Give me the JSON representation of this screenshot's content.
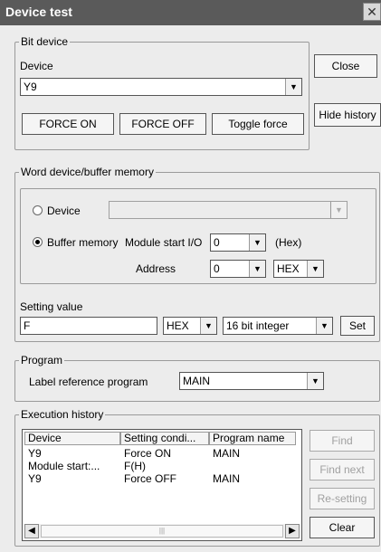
{
  "window": {
    "title": "Device test"
  },
  "side_buttons": {
    "close": "Close",
    "hide_history": "Hide history"
  },
  "bit_device": {
    "group_label": "Bit device",
    "device_label": "Device",
    "device_value": "Y9",
    "force_on": "FORCE ON",
    "force_off": "FORCE OFF",
    "toggle_force": "Toggle force"
  },
  "word_device": {
    "group_label": "Word device/buffer memory",
    "device_radio_label": "Device",
    "device_selected": false,
    "buffer_radio_label": "Buffer memory",
    "buffer_selected": true,
    "module_start_label": "Module start I/O",
    "module_start_value": "0",
    "hex_label": "(Hex)",
    "address_label": "Address",
    "address_value": "0",
    "address_format": "HEX"
  },
  "setting_value": {
    "label": "Setting value",
    "value": "F",
    "format": "HEX",
    "type": "16 bit integer",
    "set_button": "Set"
  },
  "program": {
    "group_label": "Program",
    "label_ref": "Label reference program",
    "value": "MAIN"
  },
  "history": {
    "group_label": "Execution history",
    "columns": [
      "Device",
      "Setting condi...",
      "Program name"
    ],
    "rows": [
      [
        "Y9",
        "Force ON",
        "MAIN"
      ],
      [
        "Module start:...",
        "F(H)",
        ""
      ],
      [
        "Y9",
        "Force OFF",
        "MAIN"
      ]
    ],
    "scroll_grip": "|||",
    "buttons": {
      "find": "Find",
      "find_next": "Find next",
      "resetting": "Re-setting",
      "clear": "Clear"
    }
  },
  "icons": {
    "close": "close-icon",
    "dropdown": "chevron-down-icon",
    "scroll_left": "arrow-left-icon",
    "scroll_right": "arrow-right-icon"
  }
}
